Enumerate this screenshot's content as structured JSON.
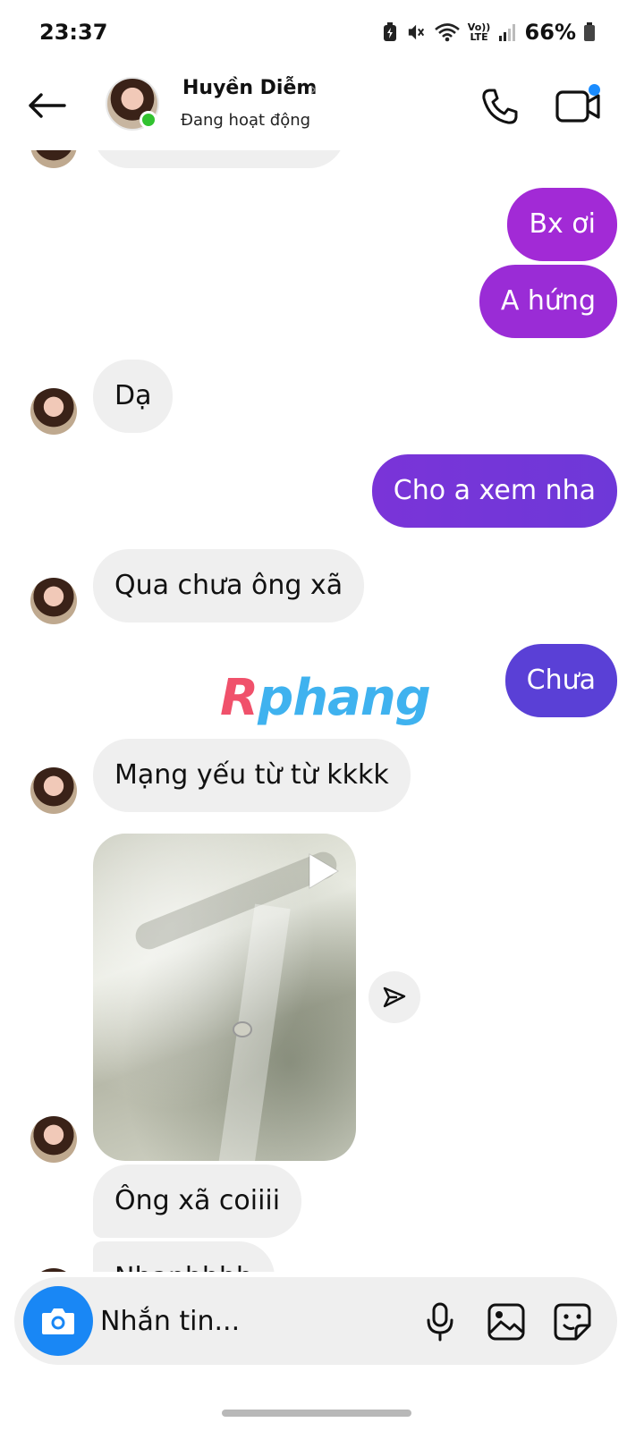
{
  "status_bar": {
    "time": "23:37",
    "network_top": "Vo))",
    "network_bottom": "LTE",
    "battery_percent": "66%",
    "icons": [
      "battery-saver-icon",
      "mute-icon",
      "wifi-icon",
      "volte-icon",
      "signal-icon",
      "battery-icon"
    ]
  },
  "header": {
    "contact_name": "Huyền Diễm",
    "contact_status": "Đang hoạt động",
    "online": true,
    "icons": [
      "back-arrow-icon",
      "chevron-right-icon",
      "phone-icon",
      "video-camera-icon"
    ],
    "video_badge_color": "#1a8cff"
  },
  "messages": [
    {
      "direction": "outgoing",
      "text": "Bx ơi"
    },
    {
      "direction": "outgoing",
      "text": "A hứng"
    },
    {
      "direction": "incoming",
      "text": "Dạ"
    },
    {
      "direction": "outgoing",
      "text": "Cho a xem nha"
    },
    {
      "direction": "incoming",
      "text": "Qua chưa ông xã"
    },
    {
      "direction": "outgoing",
      "text": "Chưa"
    },
    {
      "direction": "incoming",
      "text": "Mạng yếu từ từ kkkk"
    },
    {
      "direction": "incoming",
      "type": "video",
      "icons": [
        "play-icon",
        "share-icon"
      ]
    },
    {
      "direction": "incoming",
      "text": "Ông xã coiiii"
    },
    {
      "direction": "incoming",
      "text": "Nhanhhhh"
    }
  ],
  "watermark": {
    "first_letter": "R",
    "rest": "phang"
  },
  "composer": {
    "placeholder": "Nhắn tin...",
    "icons": [
      "camera-icon",
      "microphone-icon",
      "gallery-icon",
      "sticker-icon"
    ]
  },
  "colors": {
    "outgoing_gradient": [
      "#a12ad8",
      "#5b3fd6"
    ],
    "incoming_bubble": "#efefef",
    "online_dot": "#31c22f",
    "camera_button": "#1987f5",
    "watermark_r": "#f0516b",
    "watermark_rest": "#3fb2ef"
  }
}
